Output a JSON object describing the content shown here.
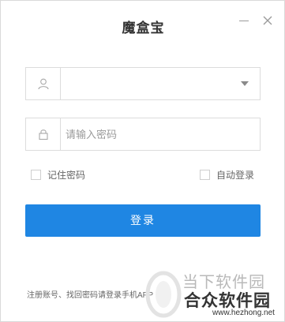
{
  "window": {
    "title": "魔盒宝",
    "minimize_icon": "minimize-icon",
    "close_icon": "close-icon"
  },
  "login_form": {
    "username": {
      "value": "",
      "placeholder": "",
      "icon": "user-icon",
      "dropdown_icon": "dropdown-arrow-icon"
    },
    "password": {
      "value": "",
      "placeholder": "请输入密码",
      "icon": "lock-icon"
    },
    "remember_password_label": "记住密码",
    "auto_login_label": "自动登录",
    "submit_label": "登录"
  },
  "footer": {
    "note": "注册账号、找回密码请登录手机APP"
  },
  "watermark": {
    "line1": "当下软件园",
    "line2": "合众软件园",
    "url": "www.hezhong.net"
  },
  "colors": {
    "accent": "#1f86e3",
    "border": "#dcdcdc",
    "text": "#333333"
  }
}
